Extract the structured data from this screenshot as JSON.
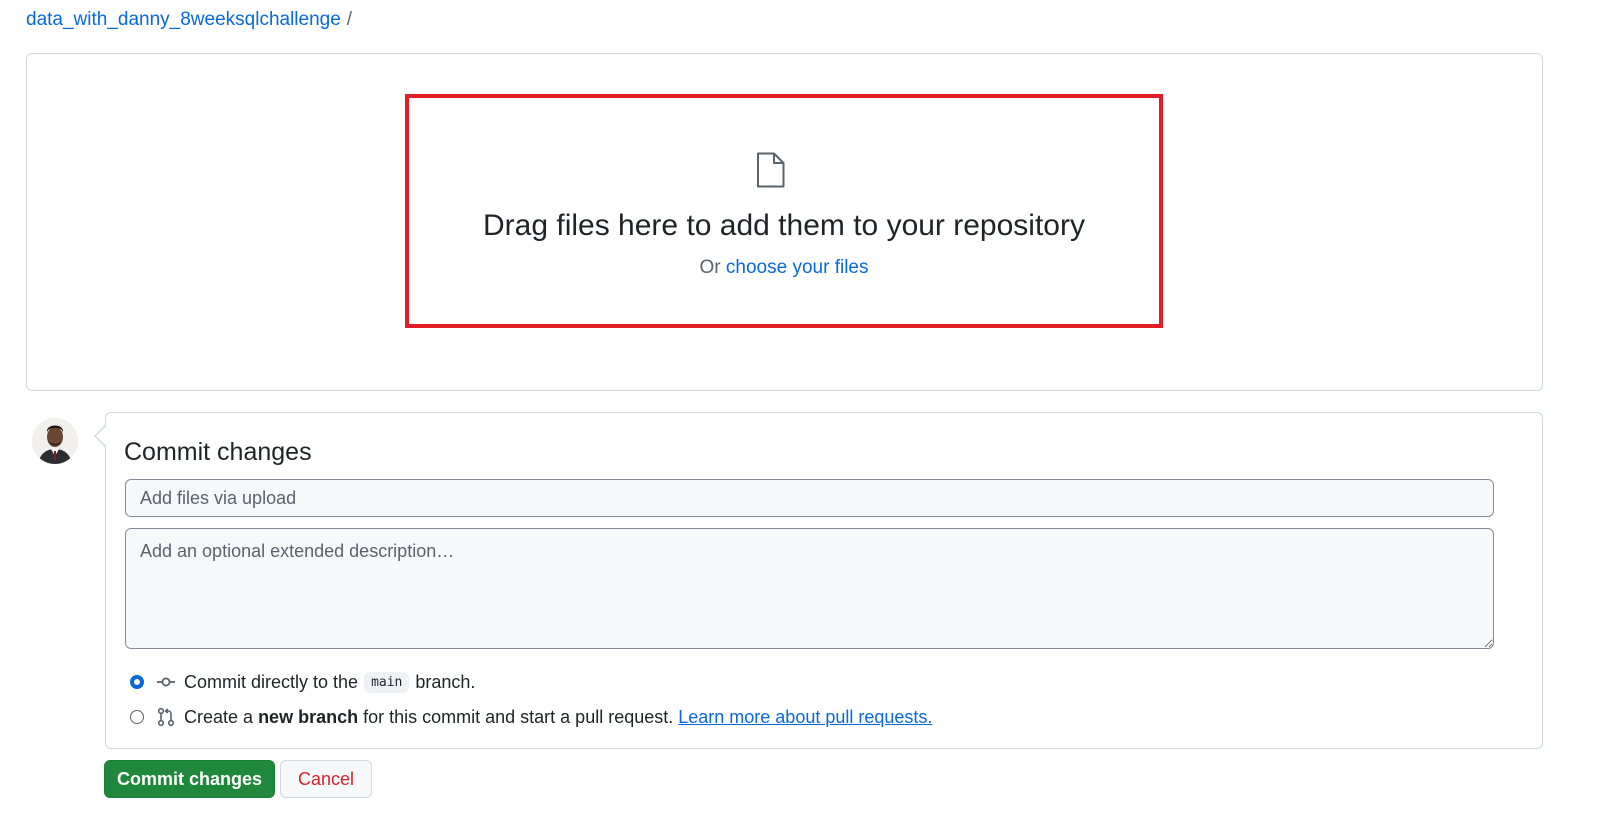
{
  "breadcrumb": {
    "repo": "data_with_danny_8weeksqlchallenge",
    "separator": "/"
  },
  "upload": {
    "title": "Drag files here to add them to your repository",
    "or_text": "Or",
    "choose_link": "choose your files",
    "highlight_color": "#e11d25"
  },
  "commit": {
    "title": "Commit changes",
    "summary_placeholder": "Add files via upload",
    "description_placeholder": "Add an optional extended description…",
    "option_direct": {
      "prefix": "Commit directly to the",
      "branch": "main",
      "suffix": "branch.",
      "selected": true
    },
    "option_new_branch": {
      "prefix": "Create a",
      "bold": "new branch",
      "suffix": "for this commit and start a pull request.",
      "link": "Learn more about pull requests.",
      "selected": false
    }
  },
  "buttons": {
    "commit": "Commit changes",
    "cancel": "Cancel"
  },
  "colors": {
    "link": "#0969da",
    "primary_button": "#1f883d",
    "danger_text": "#d1242f"
  }
}
